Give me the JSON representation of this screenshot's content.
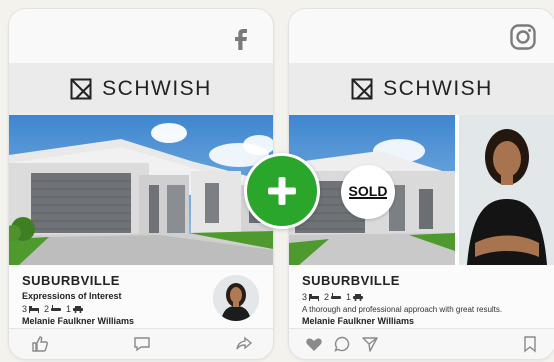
{
  "brand": {
    "name": "SCHWISH"
  },
  "facebook_card": {
    "network_icon": "facebook-icon",
    "listing": {
      "suburb": "SUBURBVILLE",
      "subtitle": "Expressions of Interest",
      "beds": "3",
      "baths": "2",
      "cars": "1",
      "agent": "Melanie Faulkner Williams"
    },
    "actions": [
      "like-icon",
      "comment-icon",
      "share-icon"
    ]
  },
  "instagram_card": {
    "network_icon": "instagram-icon",
    "badge": "SOLD",
    "listing": {
      "suburb": "SUBURBVILLE",
      "beds": "3",
      "baths": "2",
      "cars": "1",
      "description": "A thorough and professional approach with great results.",
      "agent": "Melanie Faulkner Williams"
    },
    "actions": [
      "heart-icon",
      "comment-icon",
      "send-icon",
      "bookmark-icon"
    ]
  },
  "combine_button": {
    "icon": "plus-icon"
  },
  "colors": {
    "accent_green": "#2aa62a",
    "sky": "#5b9fd6",
    "facade": "#6f7377",
    "lawn": "#4e9a2e"
  }
}
